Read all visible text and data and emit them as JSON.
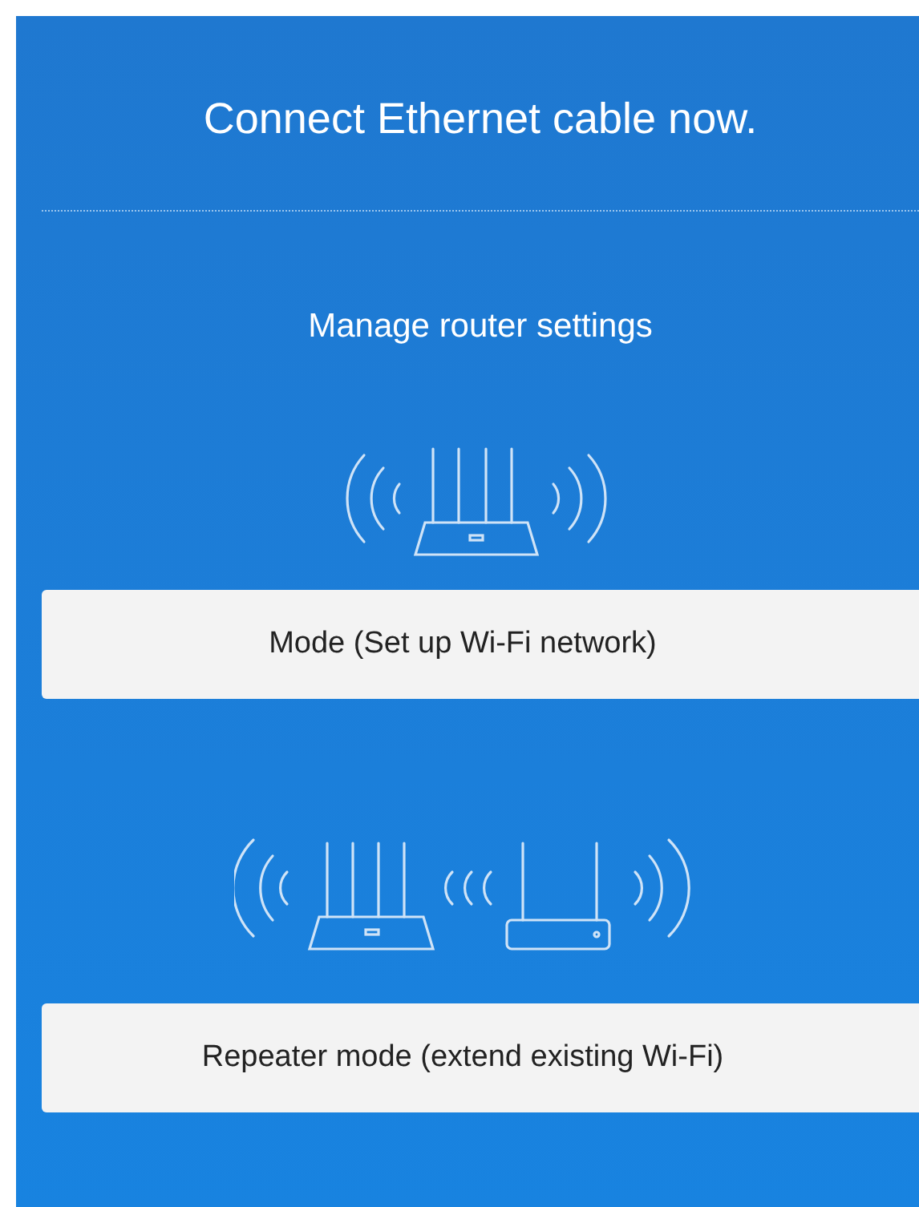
{
  "title": "Connect Ethernet cable now.",
  "section_heading": "Manage router settings",
  "options": [
    {
      "kind": "router",
      "label": "Mode (Set up Wi-Fi network)"
    },
    {
      "kind": "repeater",
      "label": "Repeater mode (extend existing Wi-Fi)"
    }
  ]
}
